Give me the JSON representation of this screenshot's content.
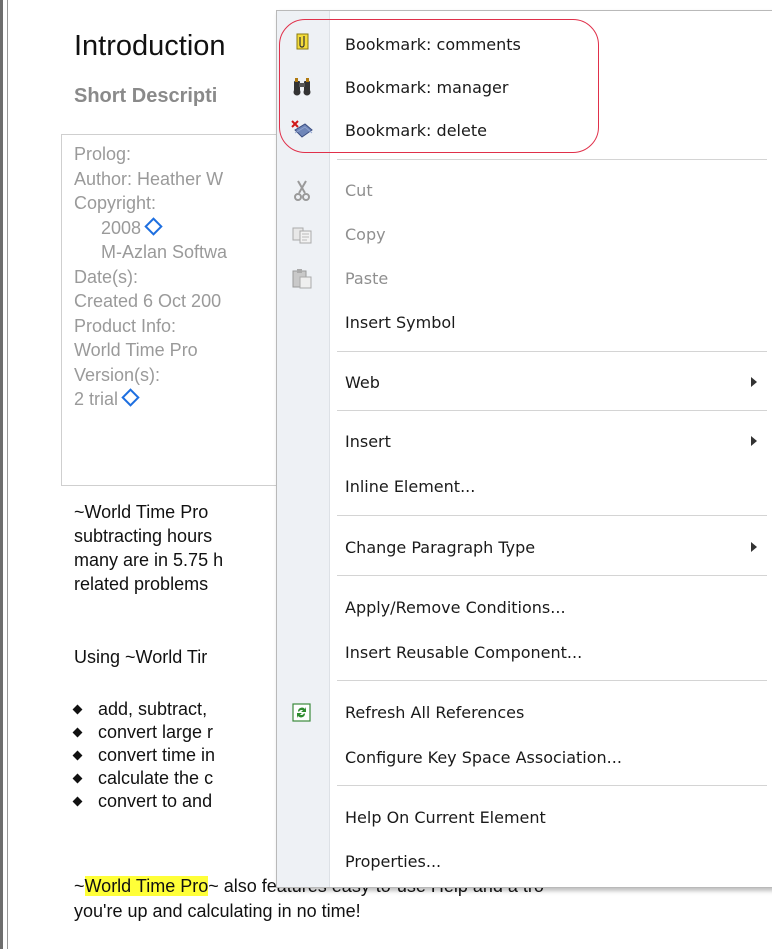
{
  "document": {
    "title": "Introduction",
    "short_description": "Short Descripti",
    "prolog": {
      "heading": "Prolog:",
      "author": "Author: Heather W",
      "copyright_label": "Copyright:",
      "copyright_year": "2008",
      "copyright_holder": "M-Azlan Softwa",
      "dates_label": "Date(s):",
      "created": "Created 6 Oct 200",
      "product_info_label": "Product Info:",
      "product_name": "World Time Pro",
      "versions_label": "Version(s):",
      "version_value": "2 trial"
    },
    "paragraph1": [
      "~World Time Pro",
      "subtracting hours",
      "many are in 5.75 h",
      "related problems"
    ],
    "paragraph2": "Using ~World Tir",
    "bullets": [
      "add, subtract,",
      "convert large r",
      "convert time in",
      "calculate the c",
      "convert to and"
    ],
    "paragraph3": {
      "prefix": "~",
      "highlight": "World Time Pro",
      "rest": "~ also features easy-to-use Help and a tro",
      "line2": "you're up and calculating in no time!"
    }
  },
  "context_menu": {
    "items": [
      {
        "label": "Bookmark: comments",
        "icon": "bookmark-comments-icon",
        "enabled": true
      },
      {
        "label": "Bookmark: manager",
        "icon": "binoculars-icon",
        "enabled": true
      },
      {
        "label": "Bookmark: delete",
        "icon": "bookmark-delete-icon",
        "enabled": true
      },
      {
        "label": "Cut",
        "icon": "scissors-icon",
        "enabled": false
      },
      {
        "label": "Copy",
        "icon": "copy-icon",
        "enabled": false
      },
      {
        "label": "Paste",
        "icon": "paste-icon",
        "enabled": false
      },
      {
        "label": "Insert Symbol",
        "enabled": true
      },
      {
        "label": "Web",
        "submenu": true,
        "enabled": true
      },
      {
        "label": "Insert",
        "submenu": true,
        "enabled": true
      },
      {
        "label": "Inline Element...",
        "enabled": true
      },
      {
        "label": "Change Paragraph Type",
        "submenu": true,
        "enabled": true
      },
      {
        "label": "Apply/Remove Conditions...",
        "enabled": true
      },
      {
        "label": "Insert Reusable Component...",
        "enabled": true
      },
      {
        "label": "Refresh All References",
        "icon": "refresh-icon",
        "enabled": true
      },
      {
        "label": "Configure Key Space Association...",
        "enabled": true
      },
      {
        "label": "Help On Current Element",
        "enabled": true
      },
      {
        "label": "Properties...",
        "enabled": true
      }
    ]
  },
  "colors": {
    "highlight": "#ffff38",
    "annotation_oval": "#e0304a",
    "link_diamond": "#1e6fe0",
    "disabled_text": "#8f8f8f"
  }
}
